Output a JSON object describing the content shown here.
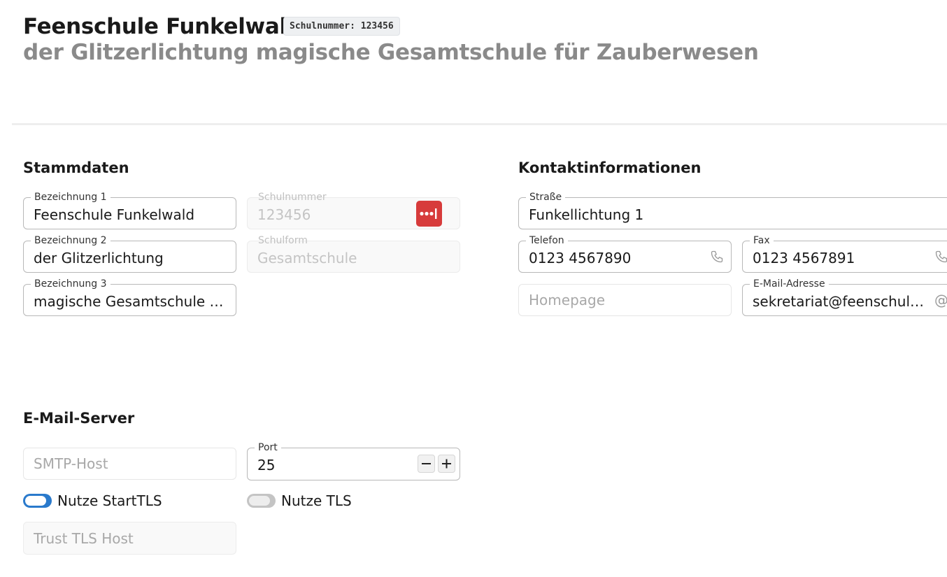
{
  "header": {
    "title": "Feenschule Funkelwald",
    "badge": "Schulnummer: 123456",
    "subtitle": "der Glitzerlichtung magische Gesamtschule für Zauberwesen"
  },
  "stammdaten": {
    "title": "Stammdaten",
    "bezeichnung1": {
      "label": "Bezeichnung 1",
      "value": "Feenschule Funkelwald"
    },
    "bezeichnung2": {
      "label": "Bezeichnung 2",
      "value": "der Glitzerlichtung"
    },
    "bezeichnung3": {
      "label": "Bezeichnung 3",
      "value": "magische Gesamtschule für..."
    },
    "schulnummer": {
      "label": "Schulnummer",
      "value": "123456"
    },
    "schulform": {
      "label": "Schulform",
      "value": "Gesamtschule"
    },
    "password_icon": "password-manager-icon"
  },
  "kontakt": {
    "title": "Kontaktinformationen",
    "strasse": {
      "label": "Straße",
      "value": "Funkellichtung 1"
    },
    "telefon": {
      "label": "Telefon",
      "value": "0123 4567890",
      "icon": "phone-icon"
    },
    "fax": {
      "label": "Fax",
      "value": "0123 4567891",
      "icon": "phone-icon"
    },
    "homepage": {
      "placeholder": "Homepage"
    },
    "email": {
      "label": "E-Mail-Adresse",
      "value": "sekretariat@feenschule-...",
      "icon": "at-icon"
    }
  },
  "mailserver": {
    "title": "E-Mail-Server",
    "smtp_host": {
      "placeholder": "SMTP-Host"
    },
    "port": {
      "label": "Port",
      "value": "25"
    },
    "starttls": {
      "label": "Nutze StartTLS",
      "checked": true
    },
    "tls": {
      "label": "Nutze TLS",
      "checked": false
    },
    "trust_tls_host": {
      "placeholder": "Trust TLS Host"
    }
  },
  "colors": {
    "accent": "#2a7acc",
    "password_button": "#d73b3b",
    "subtitle": "#8a8a8a"
  }
}
